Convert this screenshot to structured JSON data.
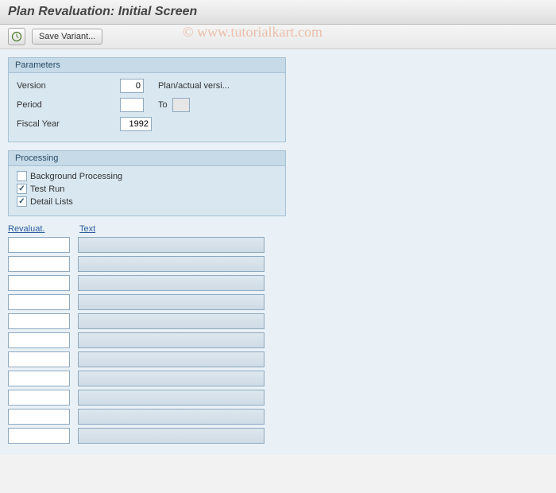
{
  "title": "Plan Revaluation: Initial Screen",
  "toolbar": {
    "save_variant_label": "Save Variant..."
  },
  "watermark": "© www.tutorialkart.com",
  "parameters": {
    "group_title": "Parameters",
    "version_label": "Version",
    "version_value": "0",
    "version_desc": "Plan/actual versi...",
    "period_label": "Period",
    "period_from": "",
    "period_to_label": "To",
    "period_to": "",
    "fiscal_year_label": "Fiscal Year",
    "fiscal_year_value": "1992"
  },
  "processing": {
    "group_title": "Processing",
    "background_label": "Background Processing",
    "background_checked": false,
    "testrun_label": "Test Run",
    "testrun_checked": true,
    "detail_label": "Detail Lists",
    "detail_checked": true
  },
  "list": {
    "col1_header": "Revaluat.",
    "col2_header": "Text",
    "rows": [
      {
        "revaluat": "",
        "text": ""
      },
      {
        "revaluat": "",
        "text": ""
      },
      {
        "revaluat": "",
        "text": ""
      },
      {
        "revaluat": "",
        "text": ""
      },
      {
        "revaluat": "",
        "text": ""
      },
      {
        "revaluat": "",
        "text": ""
      },
      {
        "revaluat": "",
        "text": ""
      },
      {
        "revaluat": "",
        "text": ""
      },
      {
        "revaluat": "",
        "text": ""
      },
      {
        "revaluat": "",
        "text": ""
      },
      {
        "revaluat": "",
        "text": ""
      }
    ]
  }
}
